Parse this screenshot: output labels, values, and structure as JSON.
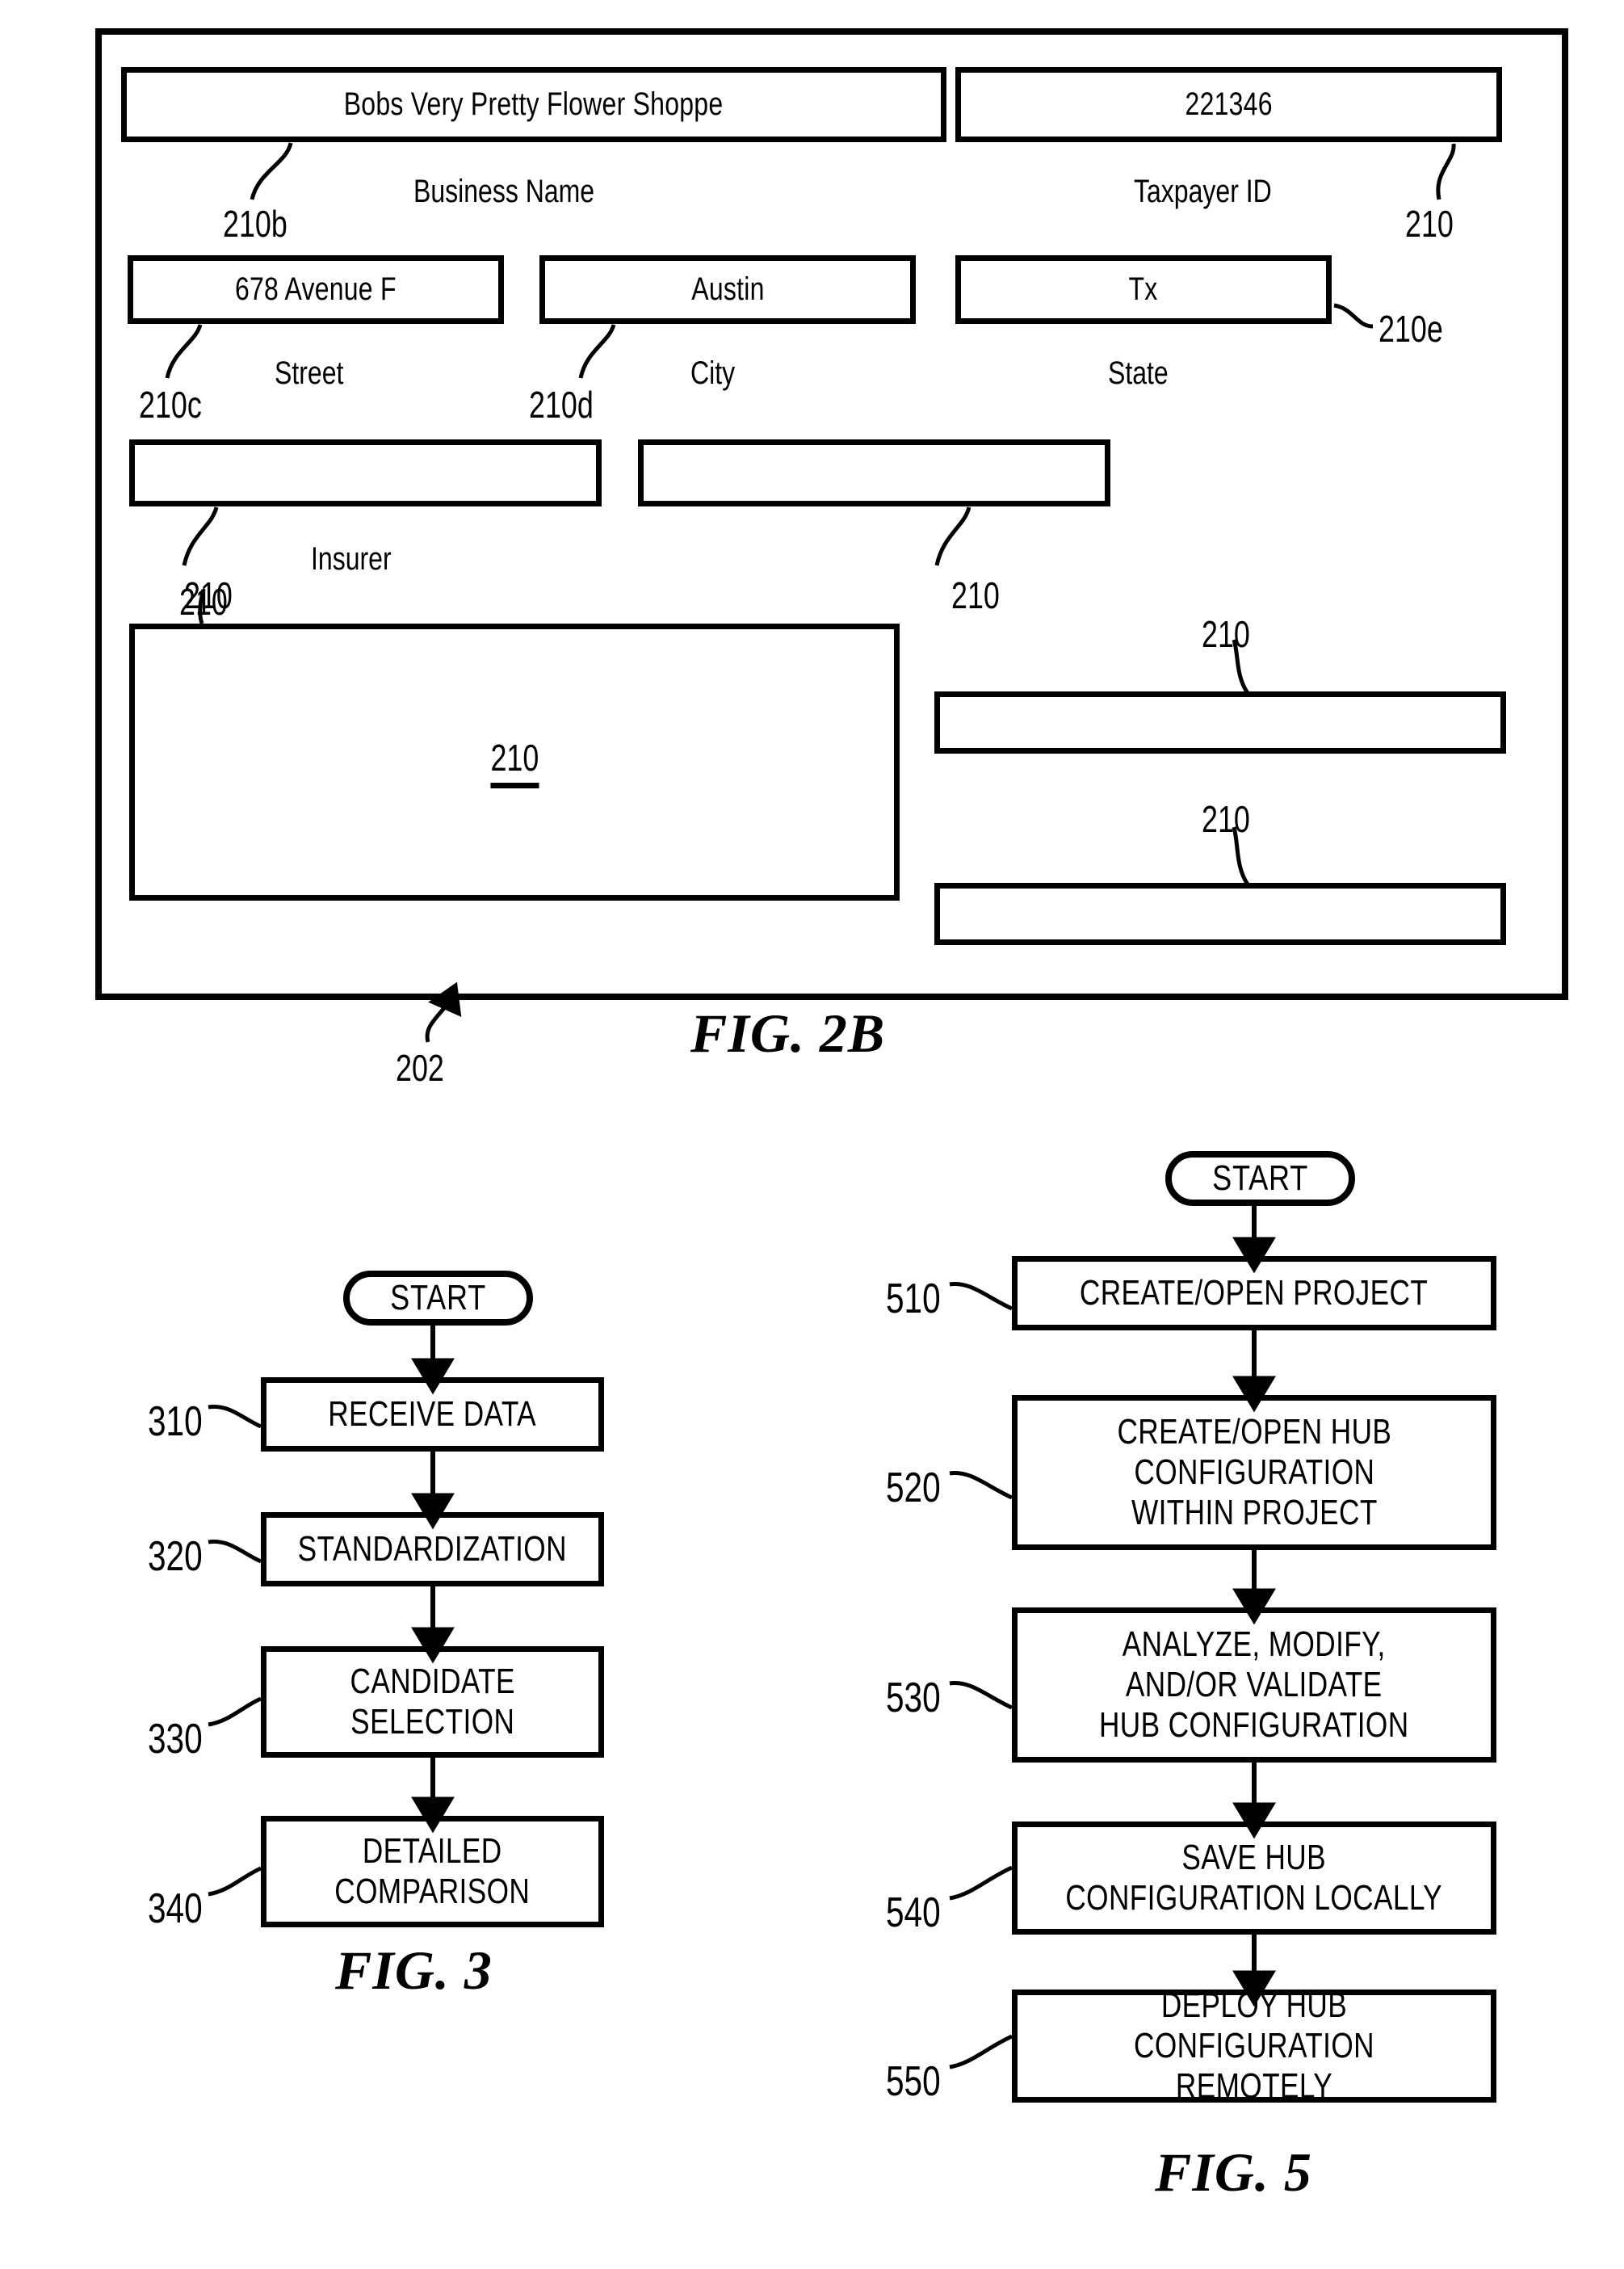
{
  "figure_2b": {
    "caption": "FIG. 2B",
    "frame_ref": "202",
    "fields": [
      {
        "value": "Bobs Very Pretty Flower Shoppe",
        "label": "Business Name",
        "ref": "210b"
      },
      {
        "value": "221346",
        "label": "Taxpayer ID",
        "ref": "210"
      },
      {
        "value": "678 Avenue F",
        "label": "Street",
        "ref": "210c"
      },
      {
        "value": "Austin",
        "label": "City",
        "ref": "210d"
      },
      {
        "value": "Tx",
        "label": "State",
        "ref": "210e"
      },
      {
        "value": "",
        "label": "Insurer",
        "ref": "210"
      },
      {
        "value": "",
        "label": "",
        "ref": "210"
      },
      {
        "value": "210",
        "label": "",
        "ref": ""
      },
      {
        "value": "",
        "label": "",
        "ref": "210"
      },
      {
        "value": "",
        "label": "",
        "ref": "210"
      }
    ],
    "big_box_label": "210",
    "refs": {
      "business_name": "210b",
      "taxpayer_id": "210",
      "street": "210c",
      "city": "210d",
      "state": "210e",
      "insurer": "210",
      "unlabeled_right": "210",
      "big_box": "210",
      "right_upper": "210",
      "right_lower": "210",
      "frame": "202"
    }
  },
  "figure_3": {
    "caption": "FIG. 3",
    "start_label": "START",
    "steps": [
      {
        "ref": "310",
        "text": "RECEIVE DATA"
      },
      {
        "ref": "320",
        "text": "STANDARDIZATION"
      },
      {
        "ref": "330",
        "text": "CANDIDATE\nSELECTION"
      },
      {
        "ref": "340",
        "text": "DETAILED\nCOMPARISON"
      }
    ]
  },
  "figure_5": {
    "caption": "FIG. 5",
    "start_label": "START",
    "steps": [
      {
        "ref": "510",
        "text": "CREATE/OPEN PROJECT"
      },
      {
        "ref": "520",
        "text": "CREATE/OPEN HUB\nCONFIGURATION\nWITHIN PROJECT"
      },
      {
        "ref": "530",
        "text": "ANALYZE, MODIFY,\nAND/OR VALIDATE\nHUB CONFIGURATION"
      },
      {
        "ref": "540",
        "text": "SAVE HUB\nCONFIGURATION LOCALLY"
      },
      {
        "ref": "550",
        "text": "DEPLOY HUB\nCONFIGURATION REMOTELY"
      }
    ]
  }
}
